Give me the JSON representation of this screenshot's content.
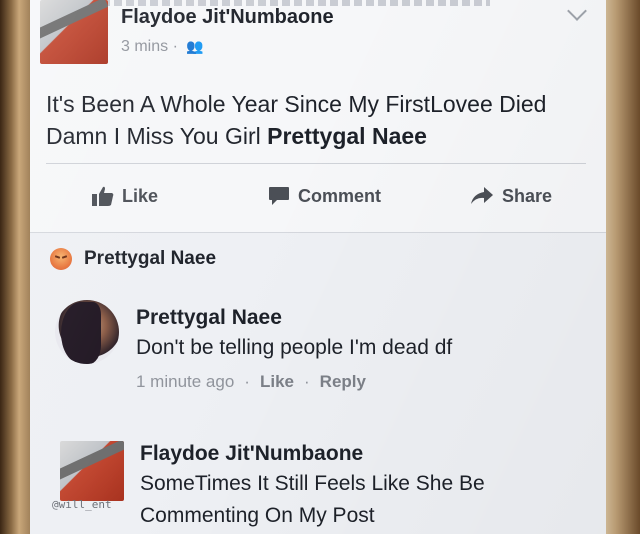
{
  "post": {
    "author": "Flaydoe Jit'Numbaone",
    "time": "3 mins",
    "separator": "·",
    "audience_icon": "friends-icon",
    "text_main": "It's Been A Whole Year Since My FirstLovee Died Damn I Miss You Girl ",
    "text_tag": "Prettygal Naee"
  },
  "actions": {
    "like": "Like",
    "comment": "Comment",
    "share": "Share"
  },
  "reaction": {
    "icon": "angry-icon",
    "name": "Prettygal Naee"
  },
  "comment": {
    "author": "Prettygal Naee",
    "text": "Don't be telling people I'm dead df",
    "time": "1 minute ago",
    "like": "Like",
    "reply": "Reply",
    "separator": "·"
  },
  "reply": {
    "author": "Flaydoe Jit'Numbaone",
    "text": "SomeTimes It Still Feels Like She Be Commenting On My Post",
    "watermark": "@will_ent"
  },
  "colors": {
    "text": "#1d2129",
    "muted": "#90949c",
    "background": "#eef0f4"
  }
}
